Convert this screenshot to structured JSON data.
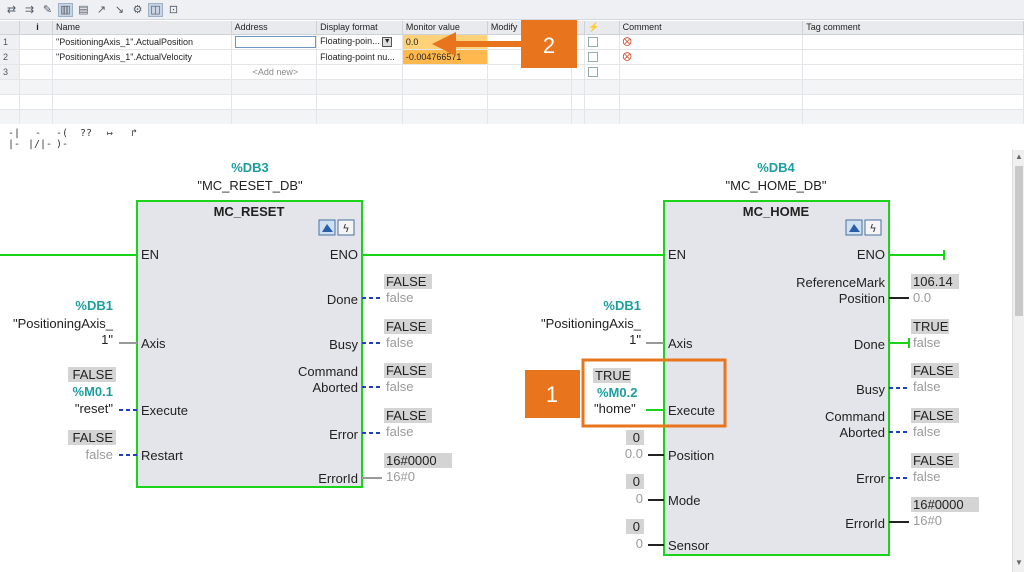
{
  "toolbar": {
    "icons": [
      "monitor-icon",
      "monitor-once-icon",
      "modify-icon",
      "display-icon",
      "display-format-icon",
      "force-icon",
      "modify-value-icon",
      "trigger-icon",
      "columns-icon",
      "columns2-icon"
    ]
  },
  "watch_table": {
    "headers": [
      "",
      "i",
      "Name",
      "Address",
      "Display format",
      "Monitor value",
      "Modify",
      "",
      "",
      "Comment",
      "Tag comment"
    ],
    "rows": [
      {
        "num": "1",
        "name": "\"PositioningAxis_1\".ActualPosition",
        "address": "",
        "display_format": "Floating-poin...",
        "monitor_value": "0.0"
      },
      {
        "num": "2",
        "name": "\"PositioningAxis_1\".ActualVelocity",
        "address": "",
        "display_format": "Floating-point nu...",
        "monitor_value": "-0.004766571"
      },
      {
        "num": "3",
        "name": "",
        "address": "<Add new>",
        "display_format": "",
        "monitor_value": ""
      }
    ]
  },
  "ladder_toolbar": {
    "items": [
      "-| |-",
      "-|/|-",
      "-( )-",
      "??",
      "↦",
      "↱"
    ]
  },
  "reset_block": {
    "db_addr": "%DB3",
    "db_name": "\"MC_RESET_DB\"",
    "title": "MC_RESET",
    "en": "EN",
    "eno": "ENO",
    "axis_db": "%DB1",
    "axis_name_1": "\"PositioningAxis_",
    "axis_name_2": "1\"",
    "axis_pin": "Axis",
    "exec_state": "FALSE",
    "exec_addr": "%M0.1",
    "exec_name": "\"reset\"",
    "exec_pin": "Execute",
    "restart_state": "FALSE",
    "restart_val": "false",
    "restart_pin": "Restart",
    "done_pin": "Done",
    "done_state": "FALSE",
    "done_val": "false",
    "busy_pin": "Busy",
    "busy_state": "FALSE",
    "busy_val": "false",
    "cmd_pin_1": "Command",
    "cmd_pin_2": "Aborted",
    "cmd_state": "FALSE",
    "cmd_val": "false",
    "error_pin": "Error",
    "error_state": "FALSE",
    "error_val": "false",
    "errid_pin": "ErrorId",
    "errid_state": "16#0000",
    "errid_val": "16#0"
  },
  "home_block": {
    "db_addr": "%DB4",
    "db_name": "\"MC_HOME_DB\"",
    "title": "MC_HOME",
    "en": "EN",
    "eno": "ENO",
    "axis_db": "%DB1",
    "axis_name_1": "\"PositioningAxis_",
    "axis_name_2": "1\"",
    "axis_pin": "Axis",
    "exec_state": "TRUE",
    "exec_addr": "%M0.2",
    "exec_name": "\"home\"",
    "exec_pin": "Execute",
    "pos_state": "0",
    "pos_val": "0.0",
    "pos_pin": "Position",
    "mode_state": "0",
    "mode_val": "0",
    "mode_pin": "Mode",
    "sensor_state": "0",
    "sensor_val": "0",
    "sensor_pin": "Sensor",
    "ref_pin_1": "ReferenceMark",
    "ref_pin_2": "Position",
    "ref_state": "106.14",
    "ref_val": "0.0",
    "done_pin": "Done",
    "done_state": "TRUE",
    "done_val": "false",
    "busy_pin": "Busy",
    "busy_state": "FALSE",
    "busy_val": "false",
    "cmd_pin_1": "Command",
    "cmd_pin_2": "Aborted",
    "cmd_state": "FALSE",
    "cmd_val": "false",
    "error_pin": "Error",
    "error_state": "FALSE",
    "error_val": "false",
    "errid_pin": "ErrorId",
    "errid_state": "16#0000",
    "errid_val": "16#0"
  },
  "callouts": {
    "one": "1",
    "two": "2"
  },
  "colors": {
    "energized": "#19d419",
    "unpowered": "#1f3fbf",
    "callout": "#e8741e",
    "monitor_bg": "#ffd27a"
  }
}
